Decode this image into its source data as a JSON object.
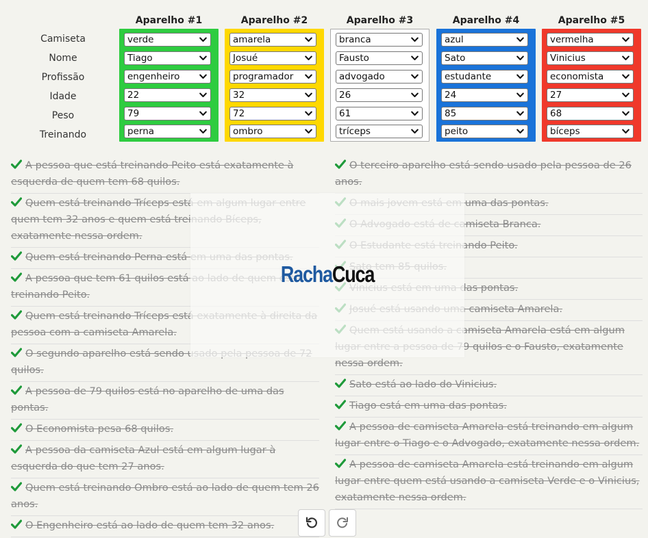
{
  "grid": {
    "row_labels": [
      "Camiseta",
      "Nome",
      "Profissão",
      "Idade",
      "Peso",
      "Treinando"
    ],
    "devices": [
      {
        "title": "Aparelho #1",
        "color": "#2ecc40",
        "values": [
          "verde",
          "Tiago",
          "engenheiro",
          "22",
          "79",
          "perna"
        ]
      },
      {
        "title": "Aparelho #2",
        "color": "#ffd800",
        "values": [
          "amarela",
          "Josué",
          "programador",
          "32",
          "72",
          "ombro"
        ]
      },
      {
        "title": "Aparelho #3",
        "color": "#ffffff",
        "values": [
          "branca",
          "Fausto",
          "advogado",
          "26",
          "61",
          "tríceps"
        ]
      },
      {
        "title": "Aparelho #4",
        "color": "#1a73d9",
        "values": [
          "azul",
          "Sato",
          "estudante",
          "24",
          "85",
          "peito"
        ]
      },
      {
        "title": "Aparelho #5",
        "color": "#f0392b",
        "values": [
          "vermelha",
          "Vinicius",
          "economista",
          "27",
          "68",
          "bíceps"
        ]
      }
    ]
  },
  "clues": {
    "left": [
      "A pessoa que está treinando Peito está exatamente à esquerda de quem tem 68 quilos.",
      "Quem está treinando Tríceps está em algum lugar entre quem tem 32 anos e quem está treinando Bíceps, exatamente nessa ordem.",
      "Quem está treinando Perna está em uma das pontas.",
      "A pessoa que tem 61 quilos está ao lado de quem está treinando Peito.",
      "Quem está treinando Tríceps está exatamente à direita da pessoa com a camiseta Amarela.",
      "O segundo aparelho está sendo usado pela pessoa de 72 quilos.",
      "A pessoa de 79 quilos está no aparelho de uma das pontas.",
      "O Economista pesa 68 quilos.",
      "A pessoa da camiseta Azul está em algum lugar à esquerda do que tem 27 anos.",
      "Quem está treinando Ombro está ao lado de quem tem 26 anos.",
      "O Engenheiro está ao lado de quem tem 32 anos."
    ],
    "right": [
      "O terceiro aparelho está sendo usado pela pessoa de 26 anos.",
      "O mais jovem está em uma das pontas.",
      "O Advogado está de camiseta Branca.",
      "O Estudante está treinando Peito.",
      "Sato tem 85 quilos.",
      "Vinicius está em uma das pontas.",
      "Josué está usando uma camiseta Amarela.",
      "Quem está usando a camiseta Amarela está em algum lugar entre a pessoa de 79 quilos e o Fausto, exatamente nessa ordem.",
      "Sato está ao lado do Vinicius.",
      "Tiago está em uma das pontas.",
      "A pessoa de camiseta Amarela está treinando em algum lugar entre o Tiago e o Advogado, exatamente nessa ordem.",
      "A pessoa de camiseta Amarela está treinando em algum lugar entre quem está usando a camiseta Verde e o Vinicius, exatamente nessa ordem."
    ]
  },
  "logo": {
    "part1": "Racha",
    "part2": "Cuca"
  },
  "colors": {
    "check": "#1e9a3a",
    "clue_text": "#8a8a8a"
  },
  "icons": {
    "check": "check-icon",
    "undo": "undo-icon",
    "redo": "redo-icon",
    "dropdown": "chevron-down-icon"
  }
}
